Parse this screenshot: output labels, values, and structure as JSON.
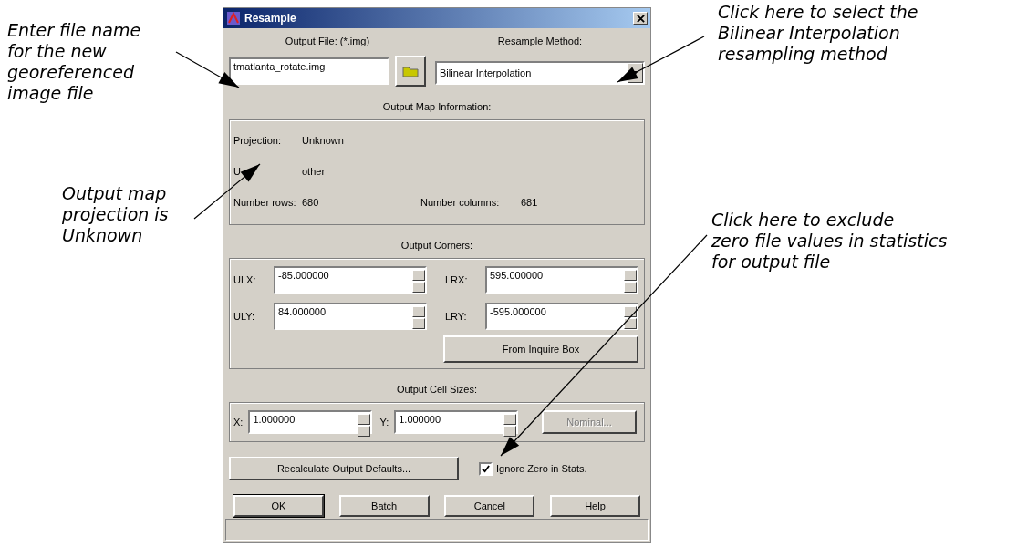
{
  "window": {
    "title": "Resample"
  },
  "output_file": {
    "label": "Output File: (*.img)",
    "value": "tmatlanta_rotate.img"
  },
  "resample_method": {
    "label": "Resample Method:",
    "value": "Bilinear Interpolation"
  },
  "map_info": {
    "heading": "Output Map Information:",
    "projection": {
      "label": "Projection:",
      "value": "Unknown"
    },
    "units": {
      "label": "U",
      "value": "other"
    },
    "number_rows": {
      "label": "Number rows:",
      "value": "680"
    },
    "number_columns": {
      "label": "Number columns:",
      "value": "681"
    }
  },
  "corners": {
    "heading": "Output Corners:",
    "fields": [
      {
        "label": "ULX:",
        "value": "-85.000000"
      },
      {
        "label": "LRX:",
        "value": "595.000000"
      },
      {
        "label": "ULY:",
        "value": "84.000000"
      },
      {
        "label": "LRY:",
        "value": "-595.000000"
      }
    ],
    "button": "From Inquire Box"
  },
  "cell_sizes": {
    "heading": "Output Cell Sizes:",
    "fields": [
      {
        "label": "X:",
        "value": "1.000000"
      },
      {
        "label": "Y:",
        "value": "1.000000"
      }
    ],
    "nominal_button": {
      "label": "Nominal...",
      "disabled": true
    }
  },
  "recalculate_button": "Recalculate Output Defaults...",
  "ignore_zero": {
    "label": "Ignore Zero in Stats.",
    "checked": true
  },
  "buttons": [
    {
      "label": "OK",
      "default": true
    },
    {
      "label": "Batch",
      "default": false
    },
    {
      "label": "Cancel",
      "default": false
    },
    {
      "label": "Help",
      "default": false
    }
  ],
  "callouts": [
    {
      "lines": [
        "Enter file name",
        "for the new",
        "georeferenced",
        "image file"
      ]
    },
    {
      "lines": [
        "Click here to select the",
        "Bilinear Interpolation",
        "resampling method"
      ]
    },
    {
      "lines": [
        "Output map",
        "projection is",
        "Unknown"
      ]
    },
    {
      "lines": [
        "Click here to exclude",
        "zero file values in statistics",
        "for output file"
      ]
    }
  ]
}
